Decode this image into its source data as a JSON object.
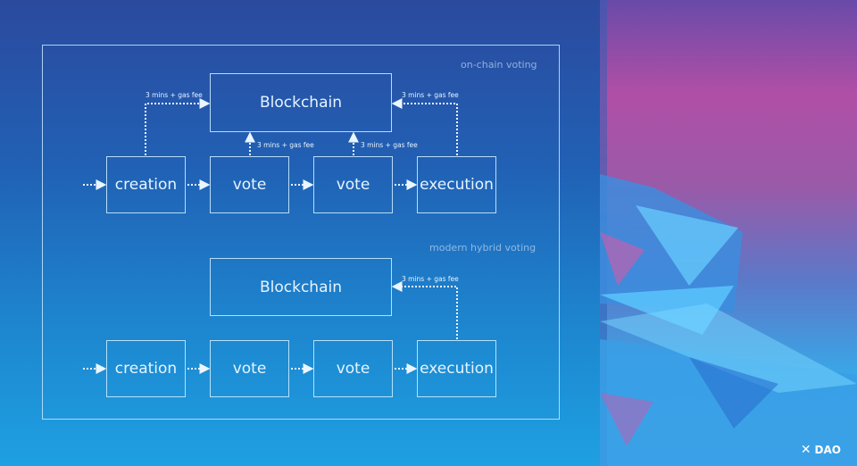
{
  "diagram": {
    "top": {
      "label": "on-chain voting",
      "blockchain": "Blockchain",
      "steps": [
        "creation",
        "vote",
        "vote",
        "execution"
      ],
      "fee_labels": [
        "3 mins + gas fee",
        "3 mins + gas fee",
        "3 mins + gas fee",
        "3 mins + gas fee"
      ]
    },
    "bottom": {
      "label": "modern hybrid voting",
      "blockchain": "Blockchain",
      "steps": [
        "creation",
        "vote",
        "vote",
        "execution"
      ],
      "fee_labels": [
        "3 mins + gas fee"
      ]
    }
  },
  "branding": {
    "logo_text": "DAO",
    "logo_icon": "x-logo-icon"
  }
}
